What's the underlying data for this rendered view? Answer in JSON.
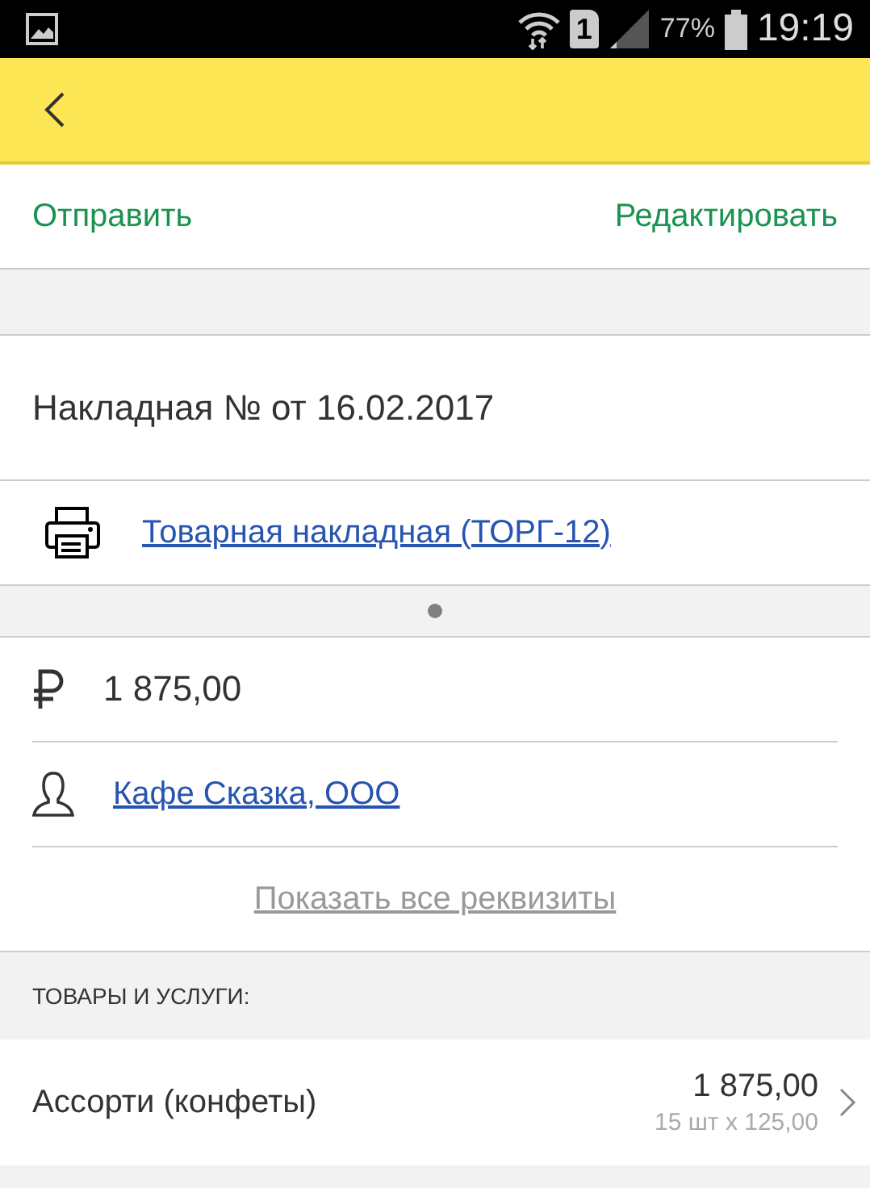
{
  "status_bar": {
    "sim": "1",
    "battery": "77%",
    "time": "19:19"
  },
  "actions": {
    "send": "Отправить",
    "edit": "Редактировать"
  },
  "document": {
    "title": "Накладная № от 16.02.2017",
    "print_form": "Товарная накладная (ТОРГ-12)"
  },
  "details": {
    "amount": "1 875,00",
    "customer": "Кафе Сказка, ООО",
    "show_all": "Показать все реквизиты"
  },
  "section": {
    "title": "ТОВАРЫ И УСЛУГИ:"
  },
  "items": [
    {
      "name": "Ассорти (конфеты)",
      "total": "1 875,00",
      "quantity": "15 шт х 125,00"
    }
  ]
}
